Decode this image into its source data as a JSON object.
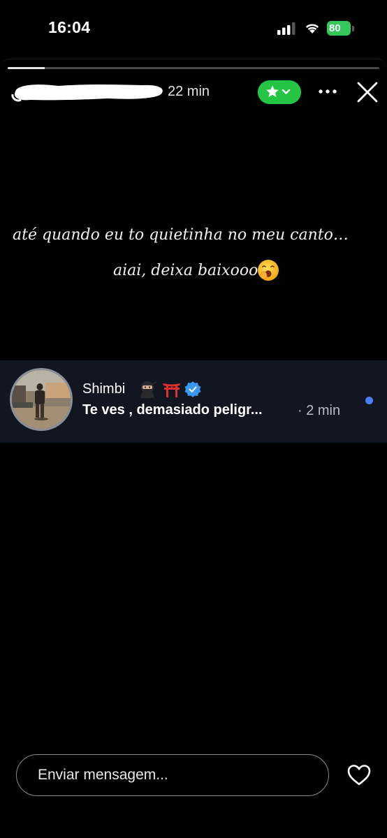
{
  "status_bar": {
    "time": "16:04",
    "battery": "80",
    "battery_color": "#34c759",
    "icons": [
      "signal-icon",
      "wifi-icon",
      "battery-icon"
    ]
  },
  "story": {
    "progress": 0.1,
    "username_redacted": true,
    "time_ago": "22 min",
    "close_friends_color": "#24c544",
    "text_line_1": "até quando eu to quietinha no meu canto…",
    "text_line_2": "aiai, deixa baixooo",
    "emoji": "yawning-face"
  },
  "reply": {
    "name": "Shimbi",
    "name_emojis": [
      "ninja-emoji",
      "torii-gate-emoji",
      "verified-badge"
    ],
    "message": "Te ves , demasiado peligr...",
    "time": "· 2 min",
    "unread_dot_color": "#4d7cf5"
  },
  "composer": {
    "placeholder": "Enviar mensagem..."
  }
}
